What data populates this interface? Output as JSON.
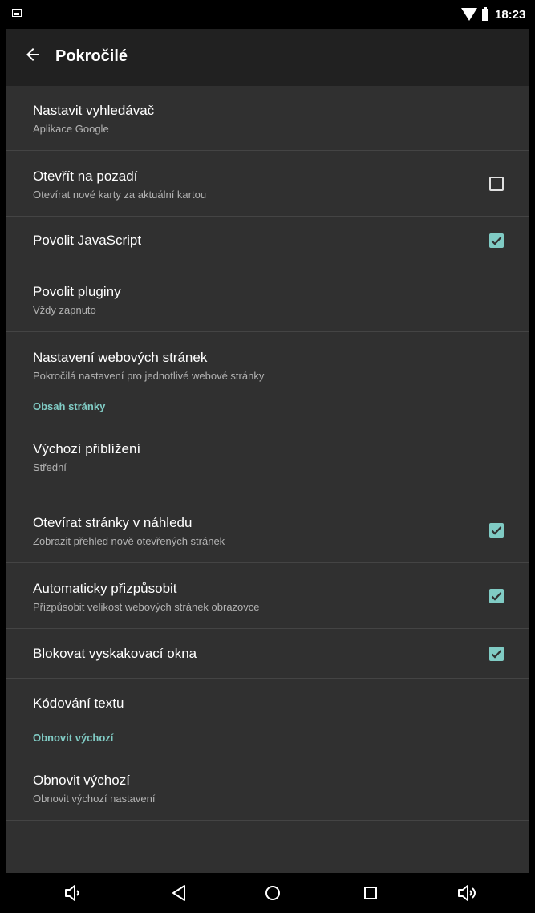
{
  "status": {
    "time": "18:23"
  },
  "toolbar": {
    "title": "Pokročilé"
  },
  "items": [
    {
      "title": "Nastavit vyhledávač",
      "summary": "Aplikace Google"
    },
    {
      "title": "Otevřít na pozadí",
      "summary": "Otevírat nové karty za aktuální kartou",
      "checked": false
    },
    {
      "title": "Povolit JavaScript",
      "checked": true
    },
    {
      "title": "Povolit pluginy",
      "summary": "Vždy zapnuto"
    },
    {
      "title": "Nastavení webových stránek",
      "summary": "Pokročilá nastavení pro jednotlivé webové stránky"
    },
    {
      "title": "Výchozí přiblížení",
      "summary": "Střední"
    },
    {
      "title": "Otevírat stránky v náhledu",
      "summary": "Zobrazit přehled nově otevřených stránek",
      "checked": true
    },
    {
      "title": "Automaticky přizpůsobit",
      "summary": "Přizpůsobit velikost webových stránek obrazovce",
      "checked": true
    },
    {
      "title": "Blokovat vyskakovací okna",
      "checked": true
    },
    {
      "title": "Kódování textu"
    },
    {
      "title": "Obnovit výchozí",
      "summary": "Obnovit výchozí nastavení"
    }
  ],
  "categories": [
    {
      "label": "Obsah stránky"
    },
    {
      "label": "Obnovit výchozí"
    }
  ],
  "colors": {
    "accent": "#80cbc4",
    "background": "#303030",
    "toolbar": "#212121"
  }
}
